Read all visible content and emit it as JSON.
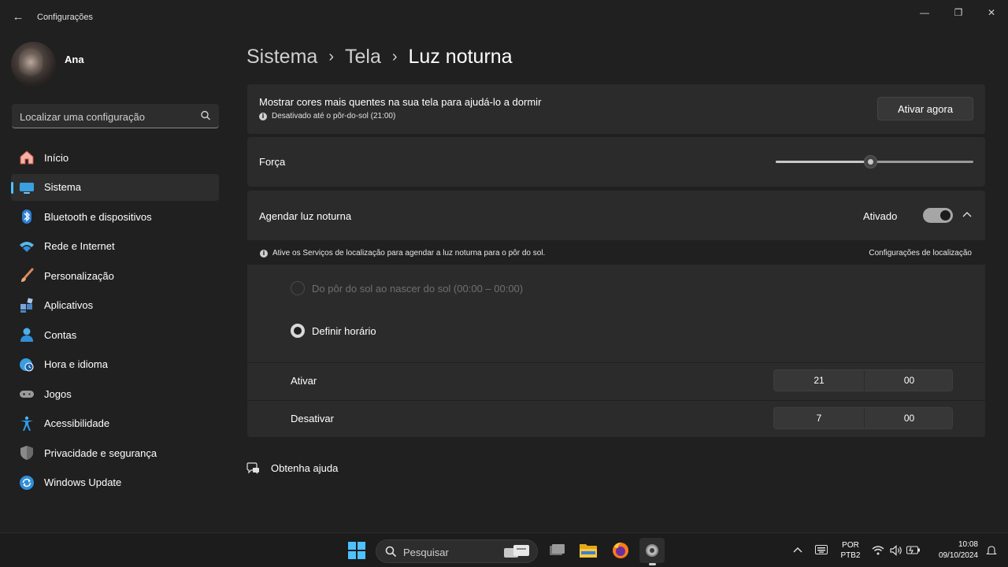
{
  "window": {
    "title": "Configurações",
    "back_glyph": "←",
    "minimize_glyph": "—",
    "maximize_glyph": "❐",
    "close_glyph": "✕"
  },
  "user": {
    "name": "Ana"
  },
  "search": {
    "placeholder": "Localizar uma configuração"
  },
  "sidebar": {
    "items": [
      {
        "label": "Início",
        "icon": "home-icon"
      },
      {
        "label": "Sistema",
        "icon": "system-icon",
        "active": true
      },
      {
        "label": "Bluetooth e dispositivos",
        "icon": "bluetooth-icon"
      },
      {
        "label": "Rede e Internet",
        "icon": "wifi-icon"
      },
      {
        "label": "Personalização",
        "icon": "brush-icon"
      },
      {
        "label": "Aplicativos",
        "icon": "apps-icon"
      },
      {
        "label": "Contas",
        "icon": "account-icon"
      },
      {
        "label": "Hora e idioma",
        "icon": "globe-clock-icon"
      },
      {
        "label": "Jogos",
        "icon": "gamepad-icon"
      },
      {
        "label": "Acessibilidade",
        "icon": "accessibility-icon"
      },
      {
        "label": "Privacidade e segurança",
        "icon": "shield-icon"
      },
      {
        "label": "Windows Update",
        "icon": "update-icon"
      }
    ]
  },
  "breadcrumb": {
    "parts": [
      "Sistema",
      "Tela"
    ],
    "current": "Luz noturna",
    "separator": "›"
  },
  "night_light": {
    "description": "Mostrar cores mais quentes na sua tela para ajudá-lo a dormir",
    "status": "Desativado até o pôr-do-sol (21:00)",
    "activate_button": "Ativar agora",
    "strength_label": "Força",
    "strength_value": 0.48
  },
  "schedule": {
    "label": "Agendar luz noturna",
    "toggle_state": "Ativado",
    "toggle_on": true,
    "info_message": "Ative os Serviços de localização para agendar a luz noturna para o pôr do sol.",
    "location_link": "Configurações de localização",
    "option_sunset": "Do pôr do sol ao nascer do sol (00:00 – 00:00)",
    "option_custom": "Definir horário",
    "on_label": "Ativar",
    "on_hour": "21",
    "on_minute": "00",
    "off_label": "Desativar",
    "off_hour": "7",
    "off_minute": "00"
  },
  "help": {
    "label": "Obtenha ajuda"
  },
  "taskbar": {
    "search_label": "Pesquisar",
    "language_line1": "POR",
    "language_line2": "PTB2",
    "time": "10:08",
    "date": "09/10/2024"
  },
  "colors": {
    "background": "#202020",
    "card": "#2b2b2b",
    "accent": "#4cc2ff",
    "taskbar": "#1c1c1c"
  }
}
